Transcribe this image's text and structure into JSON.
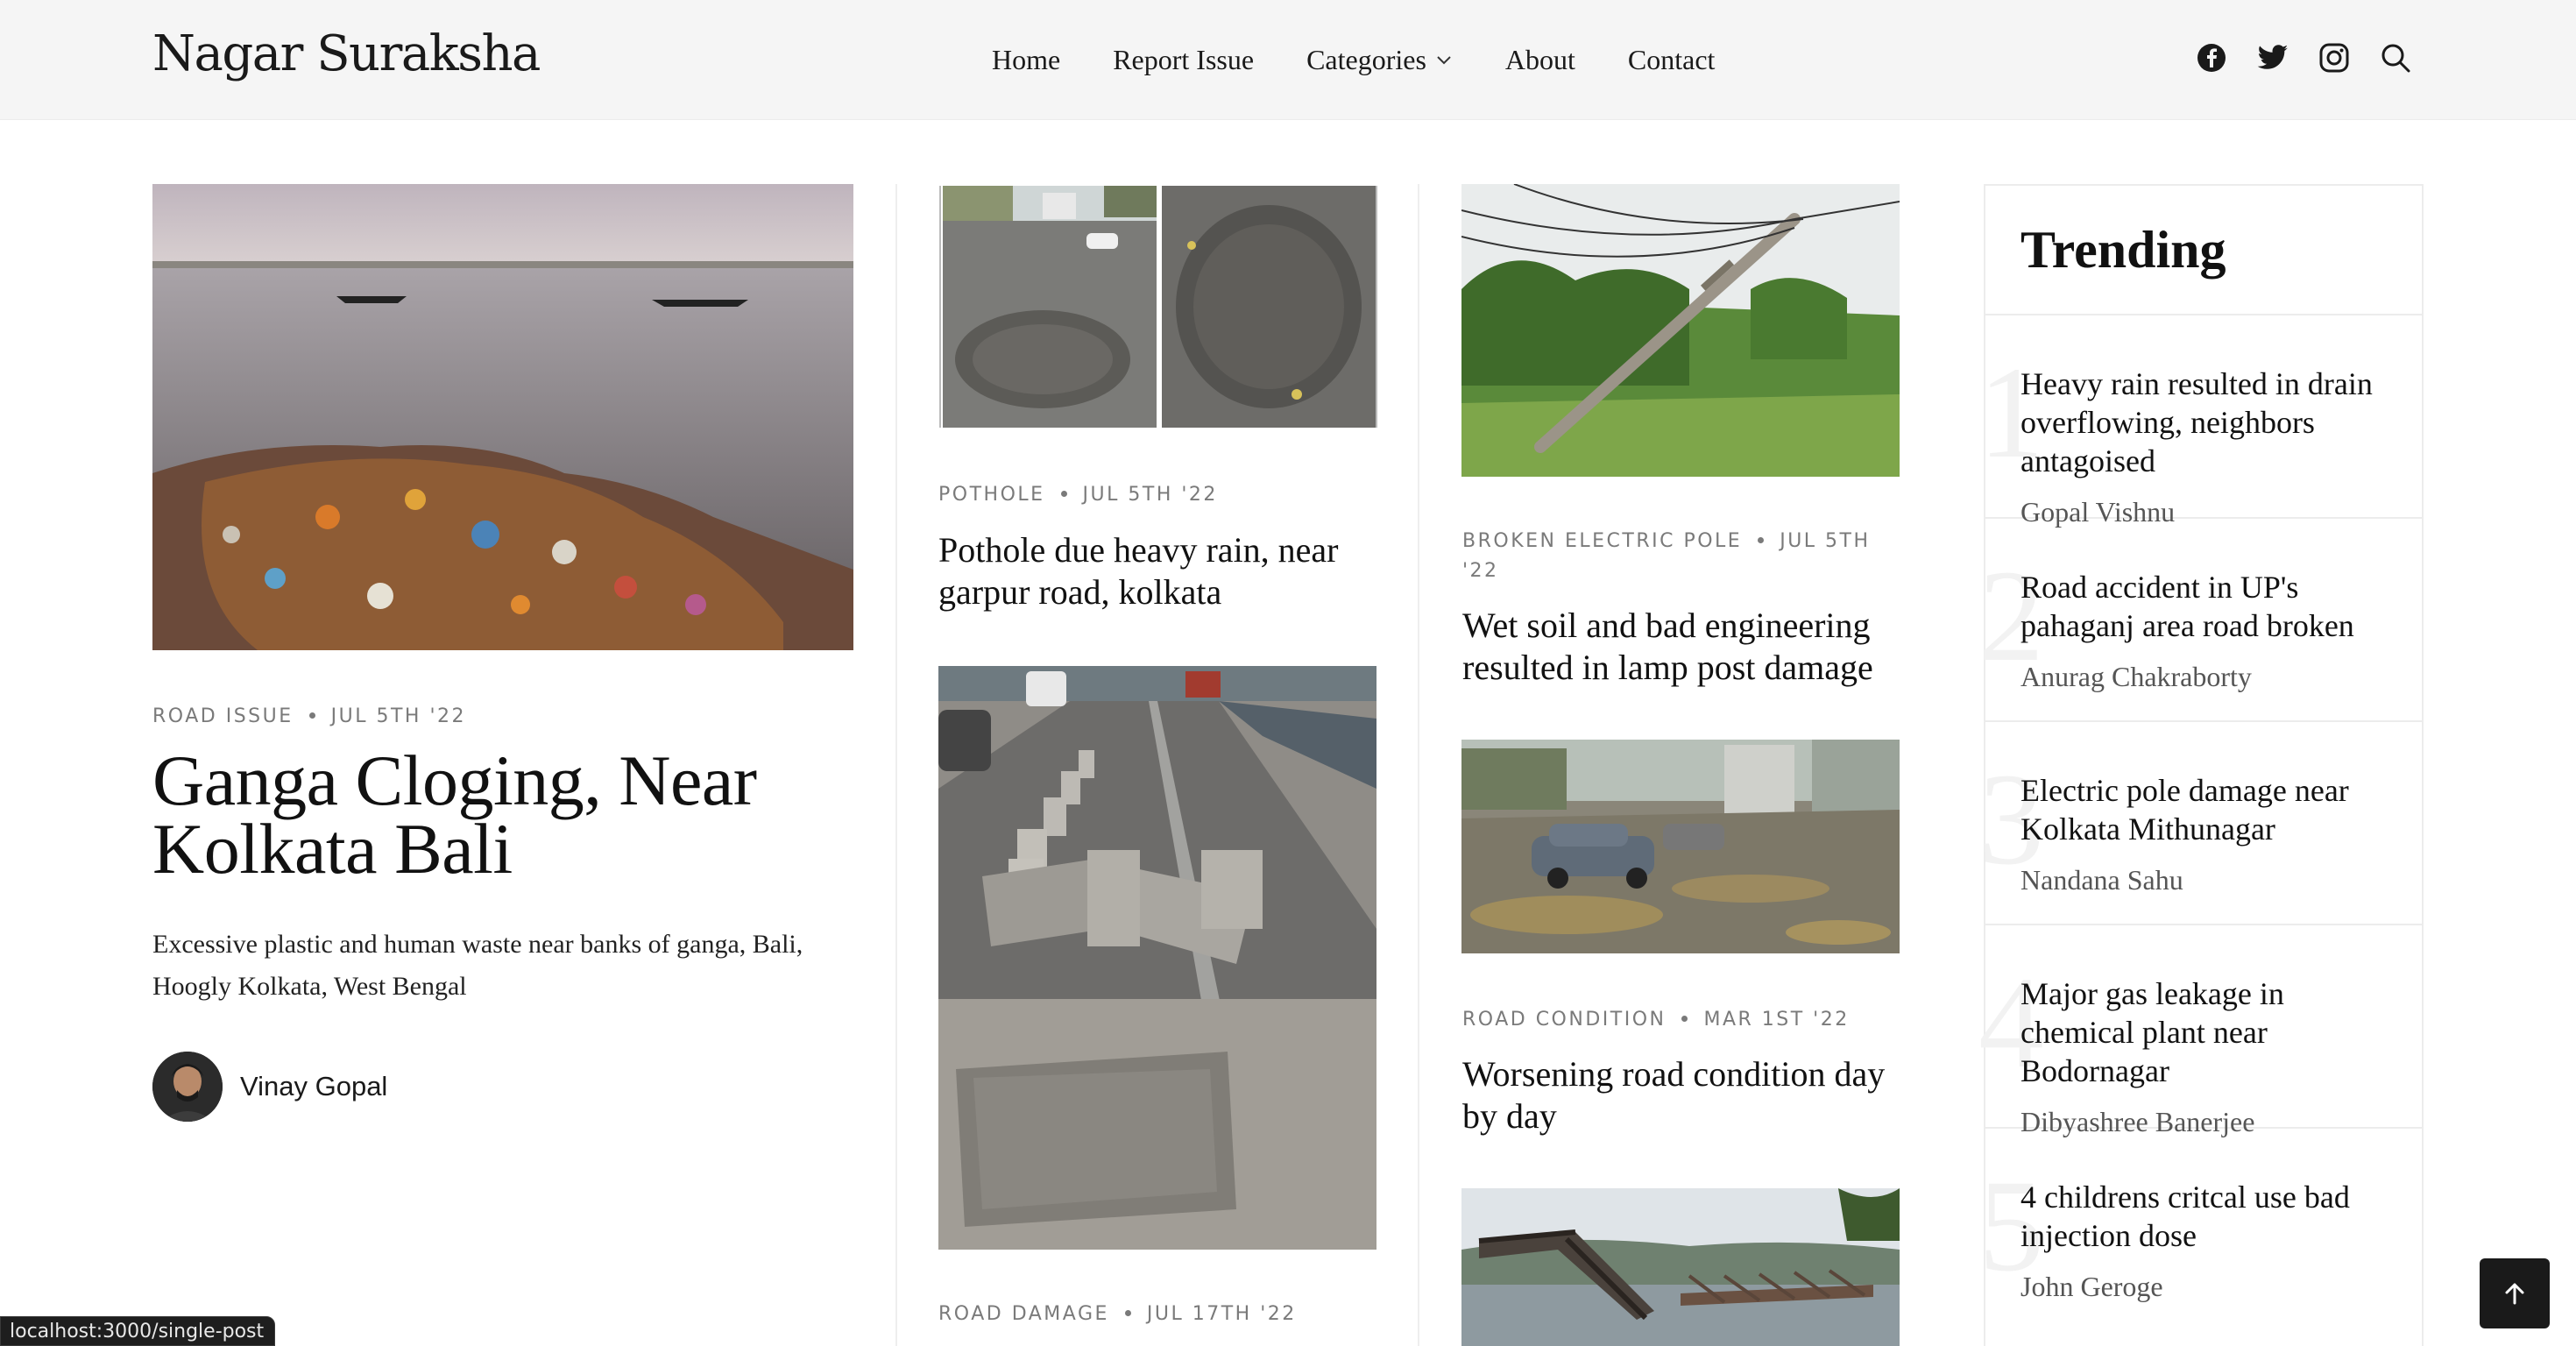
{
  "header": {
    "logo": "Nagar Suraksha",
    "nav": [
      {
        "label": "Home"
      },
      {
        "label": "Report Issue"
      },
      {
        "label": "Categories"
      },
      {
        "label": "About"
      },
      {
        "label": "Contact"
      }
    ],
    "social_icons": [
      "facebook-icon",
      "twitter-icon",
      "instagram-icon",
      "search-icon"
    ]
  },
  "featured": {
    "category": "ROAD ISSUE",
    "date": "JUL 5TH '22",
    "title": "Ganga Cloging, Near Kolkata Bali",
    "excerpt": "Excessive plastic and human waste near banks of ganga, Bali, Hoogly Kolkata, West Bengal",
    "author": "Vinay Gopal"
  },
  "column2": [
    {
      "category": "POTHOLE",
      "date": "JUL 5TH '22",
      "title": "Pothole due heavy rain, near garpur road, kolkata"
    },
    {
      "category": "ROAD DAMAGE",
      "date": "JUL 17TH '22",
      "title": ""
    }
  ],
  "column3": [
    {
      "category": "BROKEN ELECTRIC POLE",
      "date": "JUL 5TH '22",
      "title": "Wet soil and bad engineering resulted in lamp post damage"
    },
    {
      "category": "ROAD CONDITION",
      "date": "MAR 1ST '22",
      "title": "Worsening road condition day by day"
    }
  ],
  "trending": {
    "heading": "Trending",
    "items": [
      {
        "num": "1",
        "title": "Heavy rain resulted in drain overflowing, neighbors antagoised",
        "author": "Gopal Vishnu"
      },
      {
        "num": "2",
        "title": "Road accident in UP's pahaganj area road broken",
        "author": "Anurag Chakraborty"
      },
      {
        "num": "3",
        "title": "Electric pole damage near Kolkata Mithunagar",
        "author": "Nandana Sahu"
      },
      {
        "num": "4",
        "title": "Major gas leakage in chemical plant near Bodornagar",
        "author": "Dibyashree Banerjee"
      },
      {
        "num": "5",
        "title": "4 childrens critcal use bad injection dose",
        "author": "John Geroge"
      }
    ]
  },
  "status_bar": {
    "url": "localhost:3000/single-post"
  },
  "back_to_top_icon": "arrow-up-icon"
}
